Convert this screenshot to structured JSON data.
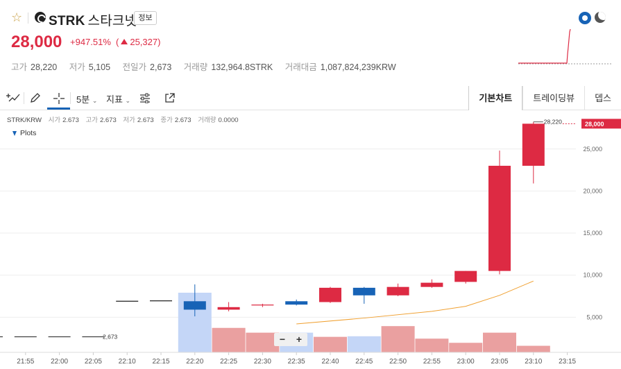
{
  "header": {
    "symbol": "STRK",
    "korean_name": "스타크넷",
    "info_button": "정보",
    "price": "28,000",
    "change_pct": "+947.51%",
    "change_amt": "25,327",
    "stats": [
      {
        "label": "고가",
        "value": "28,220",
        "tone": "hi"
      },
      {
        "label": "저가",
        "value": "5,105",
        "tone": "lo"
      },
      {
        "label": "전일가",
        "value": "2,673",
        "tone": ""
      },
      {
        "label": "거래량",
        "value": "132,964.8STRK",
        "tone": ""
      },
      {
        "label": "거래대금",
        "value": "1,087,824,239KRW",
        "tone": ""
      }
    ],
    "icons": [
      "star-icon",
      "coin-logo-icon",
      "sun-icon",
      "moon-icon"
    ]
  },
  "toolbar": {
    "interval": "5분",
    "indicators": "지표",
    "tabs": [
      "기본차트",
      "트레이딩뷰",
      "뎁스"
    ],
    "active_tab": "기본차트"
  },
  "chart_header": {
    "pair": "STRK/KRW",
    "open_label": "시가",
    "open": "2.673",
    "high_label": "고가",
    "high": "2.673",
    "low_label": "저가",
    "low": "2.673",
    "close_label": "종가",
    "close": "2.673",
    "volume_label": "거래량",
    "volume": "0.0000",
    "plots_label": "Plots"
  },
  "colors": {
    "up": "#dd2a43",
    "down": "#1763b6",
    "ma": "#f0a030",
    "vol_up": "#eaa0a0",
    "vol_down": "#c4d6f7"
  },
  "chart_data": {
    "type": "candlestick",
    "x_ticks": [
      "21:55",
      "22:00",
      "22:05",
      "22:10",
      "22:15",
      "22:20",
      "22:25",
      "22:30",
      "22:35",
      "22:40",
      "22:45",
      "22:50",
      "22:55",
      "23:00",
      "23:05",
      "23:10",
      "23:15"
    ],
    "y_ticks": [
      "5,000",
      "10,000",
      "15,000",
      "20,000",
      "25,000"
    ],
    "ylim": [
      0,
      31000
    ],
    "last_price_label": "28,000",
    "high_marker_label": "28,220",
    "prev_close_marker_label": "2,673",
    "candles": [
      {
        "t": "21:50",
        "o": 2673,
        "h": 2673,
        "l": 2673,
        "c": 2673
      },
      {
        "t": "21:55",
        "o": 2673,
        "h": 2673,
        "l": 2673,
        "c": 2673
      },
      {
        "t": "22:00",
        "o": 2673,
        "h": 2673,
        "l": 2673,
        "c": 2673
      },
      {
        "t": "22:05",
        "o": 2673,
        "h": 2673,
        "l": 2673,
        "c": 2673
      },
      {
        "t": "22:10",
        "o": 6900,
        "h": 6900,
        "l": 6900,
        "c": 6900
      },
      {
        "t": "22:15",
        "o": 6950,
        "h": 6950,
        "l": 6950,
        "c": 6950
      },
      {
        "t": "22:20",
        "o": 6900,
        "h": 8900,
        "l": 5105,
        "c": 5900
      },
      {
        "t": "22:25",
        "o": 5900,
        "h": 6800,
        "l": 5700,
        "c": 6200
      },
      {
        "t": "22:30",
        "o": 6400,
        "h": 6600,
        "l": 6200,
        "c": 6450
      },
      {
        "t": "22:35",
        "o": 6900,
        "h": 7100,
        "l": 6400,
        "c": 6500
      },
      {
        "t": "22:40",
        "o": 6800,
        "h": 8600,
        "l": 6700,
        "c": 8500
      },
      {
        "t": "22:45",
        "o": 8500,
        "h": 8600,
        "l": 6600,
        "c": 7600
      },
      {
        "t": "22:50",
        "o": 7600,
        "h": 9000,
        "l": 7500,
        "c": 8600
      },
      {
        "t": "22:55",
        "o": 8600,
        "h": 9500,
        "l": 8500,
        "c": 9100
      },
      {
        "t": "23:00",
        "o": 9200,
        "h": 10500,
        "l": 9000,
        "c": 10500
      },
      {
        "t": "23:05",
        "o": 10500,
        "h": 24800,
        "l": 10100,
        "c": 23000
      },
      {
        "t": "23:10",
        "o": 23000,
        "h": 28220,
        "l": 20900,
        "c": 28000
      }
    ],
    "ma_series": [
      {
        "t": "22:35",
        "v": 4200
      },
      {
        "t": "22:45",
        "v": 4900
      },
      {
        "t": "22:55",
        "v": 5700
      },
      {
        "t": "23:00",
        "v": 6300
      },
      {
        "t": "23:05",
        "v": 7600
      },
      {
        "t": "23:10",
        "v": 9300
      }
    ],
    "volume_relative": [
      {
        "t": "22:20",
        "v": 1.0,
        "dir": "down"
      },
      {
        "t": "22:25",
        "v": 0.41,
        "dir": "up"
      },
      {
        "t": "22:30",
        "v": 0.33,
        "dir": "up"
      },
      {
        "t": "22:35",
        "v": 0.33,
        "dir": "down"
      },
      {
        "t": "22:40",
        "v": 0.26,
        "dir": "up"
      },
      {
        "t": "22:45",
        "v": 0.27,
        "dir": "down"
      },
      {
        "t": "22:50",
        "v": 0.44,
        "dir": "up"
      },
      {
        "t": "22:55",
        "v": 0.23,
        "dir": "up"
      },
      {
        "t": "23:00",
        "v": 0.16,
        "dir": "up"
      },
      {
        "t": "23:05",
        "v": 0.33,
        "dir": "up"
      },
      {
        "t": "23:10",
        "v": 0.11,
        "dir": "up"
      }
    ]
  }
}
